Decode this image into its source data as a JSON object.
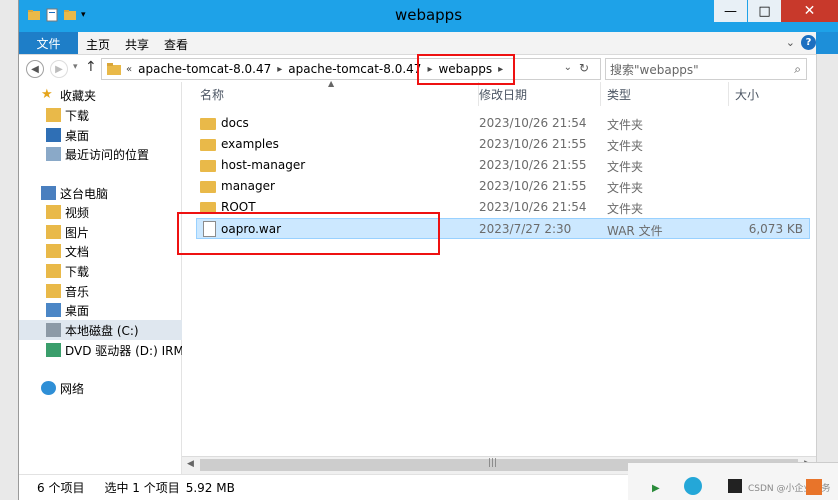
{
  "window": {
    "title": "webapps"
  },
  "ribbon": {
    "file": "文件",
    "tabs": [
      "主页",
      "共享",
      "查看"
    ]
  },
  "address": {
    "overflow": "«",
    "parts": [
      "apache-tomcat-8.0.47",
      "apache-tomcat-8.0.47",
      "webapps"
    ]
  },
  "search": {
    "placeholder": "搜索\"webapps\""
  },
  "nav": {
    "items": [
      {
        "label": "收藏夹",
        "icon": "star-icon"
      },
      {
        "label": "下载",
        "icon": "download-folder-icon"
      },
      {
        "label": "桌面",
        "icon": "desktop-icon"
      },
      {
        "label": "最近访问的位置",
        "icon": "recent-places-icon"
      },
      {
        "label": "这台电脑",
        "icon": "computer-icon"
      },
      {
        "label": "视频",
        "icon": "video-folder-icon"
      },
      {
        "label": "图片",
        "icon": "pictures-folder-icon"
      },
      {
        "label": "文档",
        "icon": "documents-folder-icon"
      },
      {
        "label": "下载",
        "icon": "download-folder-icon"
      },
      {
        "label": "音乐",
        "icon": "music-folder-icon"
      },
      {
        "label": "桌面",
        "icon": "desktop-folder-icon"
      },
      {
        "label": "本地磁盘 (C:)",
        "icon": "drive-icon"
      },
      {
        "label": "DVD 驱动器 (D:) IRM",
        "icon": "dvd-icon"
      },
      {
        "label": "网络",
        "icon": "network-icon"
      }
    ]
  },
  "columns": {
    "name": "名称",
    "date": "修改日期",
    "type": "类型",
    "size": "大小"
  },
  "files": [
    {
      "name": "docs",
      "date": "2023/10/26 21:54",
      "type": "文件夹",
      "size": ""
    },
    {
      "name": "examples",
      "date": "2023/10/26 21:55",
      "type": "文件夹",
      "size": ""
    },
    {
      "name": "host-manager",
      "date": "2023/10/26 21:55",
      "type": "文件夹",
      "size": ""
    },
    {
      "name": "manager",
      "date": "2023/10/26 21:55",
      "type": "文件夹",
      "size": ""
    },
    {
      "name": "ROOT",
      "date": "2023/10/26 21:54",
      "type": "文件夹",
      "size": ""
    },
    {
      "name": "oapro.war",
      "date": "2023/7/27 2:30",
      "type": "WAR 文件",
      "size": "6,073 KB"
    }
  ],
  "status": {
    "count": "6 个项目",
    "selected": "选中 1 个项目",
    "size": "5.92 MB"
  },
  "watermark": "CSDN @小企业服务"
}
